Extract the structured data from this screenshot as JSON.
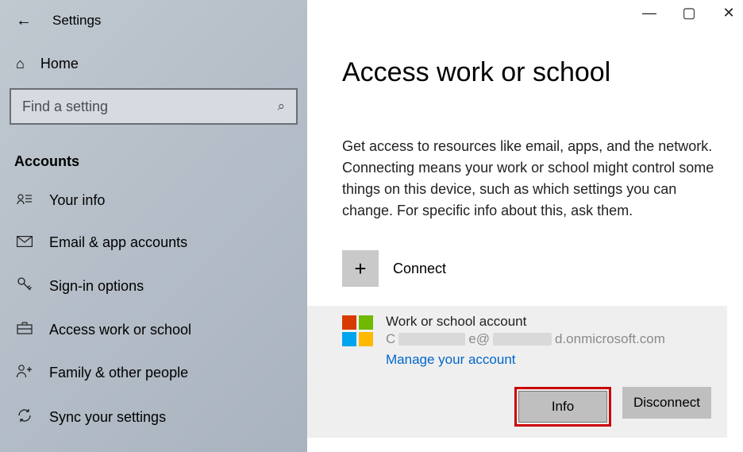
{
  "window": {
    "title": "Settings",
    "min_icon": "—",
    "max_icon": "▢",
    "close_icon": "✕"
  },
  "sidebar": {
    "home_label": "Home",
    "search_placeholder": "Find a setting",
    "section_label": "Accounts",
    "items": [
      {
        "icon": "person-card-icon",
        "glyph": "ᴿ≡",
        "label": "Your info"
      },
      {
        "icon": "mail-icon",
        "glyph": "✉",
        "label": "Email & app accounts"
      },
      {
        "icon": "key-icon",
        "glyph": "⌕",
        "label": "Sign-in options"
      },
      {
        "icon": "briefcase-icon",
        "glyph": "□",
        "label": "Access work or school"
      },
      {
        "icon": "people-icon",
        "glyph": "ᴬ₊",
        "label": "Family & other people"
      },
      {
        "icon": "sync-icon",
        "glyph": "⟳",
        "label": "Sync your settings"
      }
    ]
  },
  "page": {
    "heading": "Access work or school",
    "description": "Get access to resources like email, apps, and the network. Connecting means your work or school might control some things on this device, such as which settings you can change. For specific info about this, ask them.",
    "connect_label": "Connect"
  },
  "account": {
    "title": "Work or school account",
    "email_prefix": "C",
    "email_mid": "e@",
    "email_suffix": "d.onmicrosoft.com",
    "manage_link": "Manage your account",
    "info_btn": "Info",
    "disconnect_btn": "Disconnect"
  }
}
